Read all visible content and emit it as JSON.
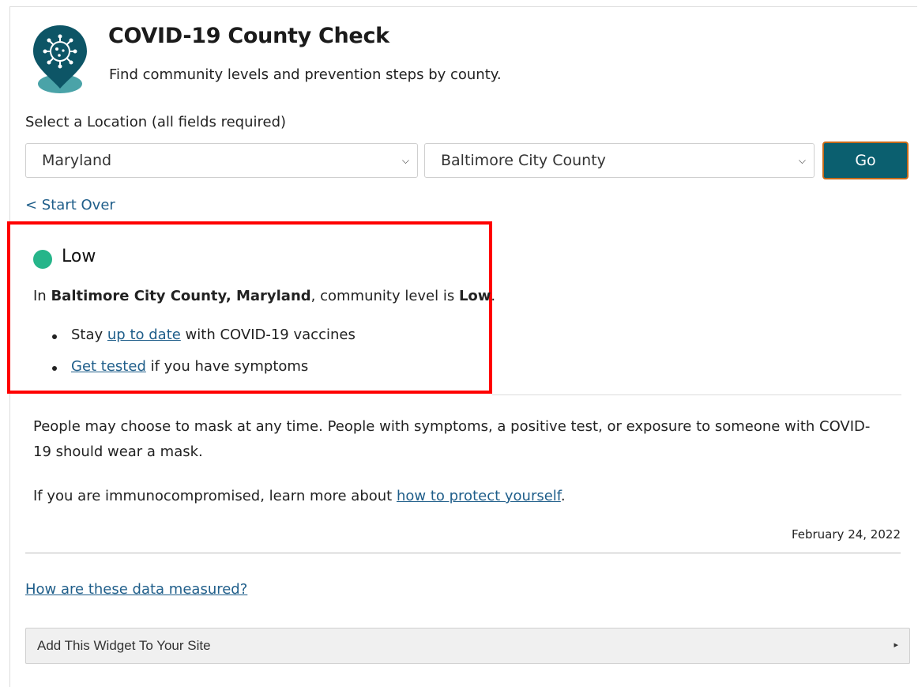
{
  "header": {
    "title": "COVID-19 County Check",
    "subtitle": "Find community levels and prevention steps by county."
  },
  "location": {
    "label": "Select a Location (all fields required)",
    "state": "Maryland",
    "county": "Baltimore City County",
    "go_label": "Go"
  },
  "start_over": "< Start Over",
  "result": {
    "level": "Low",
    "level_color": "#26b58a",
    "statement_prefix": "In ",
    "statement_place": "Baltimore City County, Maryland",
    "statement_middle": ", community level is ",
    "statement_level": "Low",
    "statement_suffix": ".",
    "bullets": [
      {
        "pre": "Stay ",
        "link": "up to date",
        "post": " with COVID-19 vaccines"
      },
      {
        "pre": "",
        "link": "Get tested",
        "post": " if you have symptoms"
      }
    ]
  },
  "mask_text": "People may choose to mask at any time. People with symptoms, a positive test, or exposure to someone with COVID-19 should wear a mask.",
  "immuno": {
    "prefix": "If you are immunocompromised, learn more about ",
    "link": "how to protect yourself",
    "suffix": "."
  },
  "date": "February 24, 2022",
  "data_link": "How are these data measured?",
  "widget": {
    "label": "Add This Widget To Your Site",
    "caret": "▸"
  },
  "colors": {
    "go_button_bg": "#0b5f6f",
    "go_button_border": "#c76a19",
    "link": "#1f5e8a",
    "highlight": "#ff0000"
  }
}
